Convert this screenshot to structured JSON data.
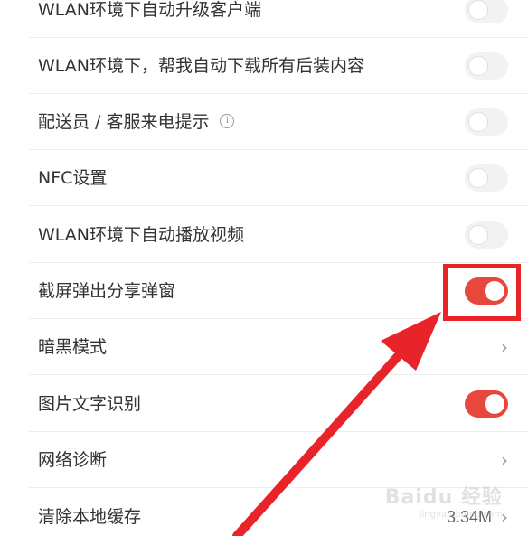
{
  "settings": {
    "items": [
      {
        "label": "WLAN环境下自动升级客户端",
        "control": "toggle",
        "state": "off"
      },
      {
        "label": "WLAN环境下，帮我自动下载所有后装内容",
        "control": "toggle",
        "state": "off"
      },
      {
        "label": "配送员 / 客服来电提示",
        "control": "toggle",
        "state": "off",
        "info_icon": "ⓘ"
      },
      {
        "label": "NFC设置",
        "control": "toggle",
        "state": "off"
      },
      {
        "label": "WLAN环境下自动播放视频",
        "control": "toggle",
        "state": "off"
      },
      {
        "label": "截屏弹出分享弹窗",
        "control": "toggle",
        "state": "on"
      },
      {
        "label": "暗黑模式",
        "control": "chevron",
        "chevron": "›"
      },
      {
        "label": "图片文字识别",
        "control": "toggle",
        "state": "on"
      },
      {
        "label": "网络诊断",
        "control": "chevron",
        "chevron": "›"
      },
      {
        "label": "清除本地缓存",
        "control": "chevron",
        "chevron": "›",
        "value": "3.34M"
      }
    ]
  },
  "colors": {
    "toggle_on": "#e8483c",
    "toggle_off": "#f2f2f2",
    "annotation_red": "#e8232a"
  },
  "annotation": {
    "highlight_target": "截屏弹出分享弹窗 toggle",
    "arrow_icon": "red-arrow"
  },
  "watermark": {
    "text": "Baidu 经验",
    "subtext": "jingyan.baidu.com"
  }
}
